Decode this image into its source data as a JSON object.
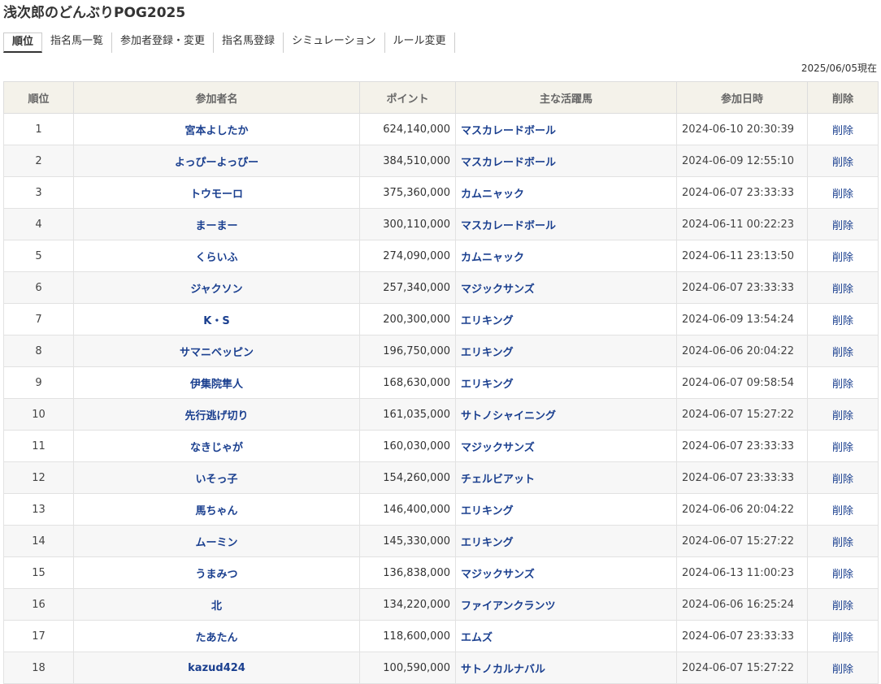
{
  "page": {
    "title": "浅次郎のどんぶりPOG2025",
    "as_of": "2025/06/05現在"
  },
  "tabs": [
    {
      "label": "順位",
      "active": true
    },
    {
      "label": "指名馬一覧",
      "active": false
    },
    {
      "label": "参加者登録・変更",
      "active": false
    },
    {
      "label": "指名馬登録",
      "active": false
    },
    {
      "label": "シミュレーション",
      "active": false
    },
    {
      "label": "ルール変更",
      "active": false
    }
  ],
  "table": {
    "headers": [
      "順位",
      "参加者名",
      "ポイント",
      "主な活躍馬",
      "参加日時",
      "削除"
    ],
    "rows": [
      {
        "rank": "1",
        "name": "宮本よしたか",
        "points": "624,140,000",
        "horse": "マスカレードボール",
        "joined": "2024-06-10 20:30:39",
        "delete": "削除"
      },
      {
        "rank": "2",
        "name": "よっぴーよっぴー",
        "points": "384,510,000",
        "horse": "マスカレードボール",
        "joined": "2024-06-09 12:55:10",
        "delete": "削除"
      },
      {
        "rank": "3",
        "name": "トウモーロ",
        "points": "375,360,000",
        "horse": "カムニャック",
        "joined": "2024-06-07 23:33:33",
        "delete": "削除"
      },
      {
        "rank": "4",
        "name": "まーまー",
        "points": "300,110,000",
        "horse": "マスカレードボール",
        "joined": "2024-06-11 00:22:23",
        "delete": "削除"
      },
      {
        "rank": "5",
        "name": "くらいふ",
        "points": "274,090,000",
        "horse": "カムニャック",
        "joined": "2024-06-11 23:13:50",
        "delete": "削除"
      },
      {
        "rank": "6",
        "name": "ジャクソン",
        "points": "257,340,000",
        "horse": "マジックサンズ",
        "joined": "2024-06-07 23:33:33",
        "delete": "削除"
      },
      {
        "rank": "7",
        "name": "K・S",
        "points": "200,300,000",
        "horse": "エリキング",
        "joined": "2024-06-09 13:54:24",
        "delete": "削除"
      },
      {
        "rank": "8",
        "name": "サマニベッピン",
        "points": "196,750,000",
        "horse": "エリキング",
        "joined": "2024-06-06 20:04:22",
        "delete": "削除"
      },
      {
        "rank": "9",
        "name": "伊集院隼人",
        "points": "168,630,000",
        "horse": "エリキング",
        "joined": "2024-06-07 09:58:54",
        "delete": "削除"
      },
      {
        "rank": "10",
        "name": "先行逃げ切り",
        "points": "161,035,000",
        "horse": "サトノシャイニング",
        "joined": "2024-06-07 15:27:22",
        "delete": "削除"
      },
      {
        "rank": "11",
        "name": "なきじゃが",
        "points": "160,030,000",
        "horse": "マジックサンズ",
        "joined": "2024-06-07 23:33:33",
        "delete": "削除"
      },
      {
        "rank": "12",
        "name": "いそっ子",
        "points": "154,260,000",
        "horse": "チェルビアット",
        "joined": "2024-06-07 23:33:33",
        "delete": "削除"
      },
      {
        "rank": "13",
        "name": "馬ちゃん",
        "points": "146,400,000",
        "horse": "エリキング",
        "joined": "2024-06-06 20:04:22",
        "delete": "削除"
      },
      {
        "rank": "14",
        "name": "ムーミン",
        "points": "145,330,000",
        "horse": "エリキング",
        "joined": "2024-06-07 15:27:22",
        "delete": "削除"
      },
      {
        "rank": "15",
        "name": "うまみつ",
        "points": "136,838,000",
        "horse": "マジックサンズ",
        "joined": "2024-06-13 11:00:23",
        "delete": "削除"
      },
      {
        "rank": "16",
        "name": "北",
        "points": "134,220,000",
        "horse": "ファイアンクランツ",
        "joined": "2024-06-06 16:25:24",
        "delete": "削除"
      },
      {
        "rank": "17",
        "name": "たあたん",
        "points": "118,600,000",
        "horse": "エムズ",
        "joined": "2024-06-07 23:33:33",
        "delete": "削除"
      },
      {
        "rank": "18",
        "name": "kazud424",
        "points": "100,590,000",
        "horse": "サトノカルナバル",
        "joined": "2024-06-07 15:27:22",
        "delete": "削除"
      }
    ]
  }
}
